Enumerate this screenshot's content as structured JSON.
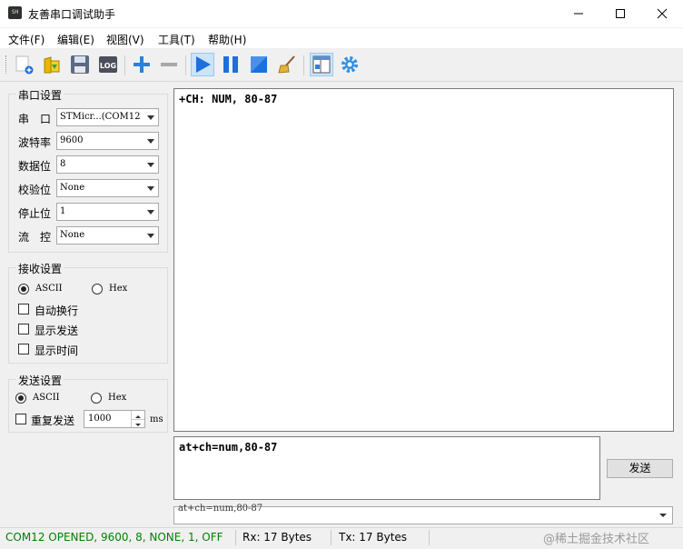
{
  "window": {
    "title": "友善串口调试助手",
    "icon_text": "SH",
    "controls": [
      "minimize",
      "maximize",
      "close"
    ]
  },
  "menu": [
    "文件(F)",
    "编辑(E)",
    "视图(V)",
    "工具(T)",
    "帮助(H)"
  ],
  "toolbar": {
    "icons": [
      "new-icon",
      "open-icon",
      "save-icon",
      "log-icon",
      "add-icon",
      "remove-icon",
      "play-icon",
      "pause-icon",
      "stop-icon",
      "clear-icon",
      "layout-icon",
      "settings-icon"
    ],
    "log_text": "LOG",
    "pressed": [
      "play-icon",
      "layout-icon"
    ]
  },
  "serial": {
    "title": "串口设置",
    "fields": [
      {
        "label": "串　口",
        "value": "STMicr...(COM12"
      },
      {
        "label": "波特率",
        "value": "9600"
      },
      {
        "label": "数据位",
        "value": "8"
      },
      {
        "label": "校验位",
        "value": "None"
      },
      {
        "label": "停止位",
        "value": "1"
      },
      {
        "label": "流　控",
        "value": "None"
      }
    ]
  },
  "receive": {
    "title": "接收设置",
    "ascii": "ASCII",
    "hex": "Hex",
    "selected": "ASCII",
    "options": [
      {
        "label": "自动换行",
        "checked": false
      },
      {
        "label": "显示发送",
        "checked": false
      },
      {
        "label": "显示时间",
        "checked": false
      }
    ]
  },
  "send": {
    "title": "发送设置",
    "ascii": "ASCII",
    "hex": "Hex",
    "selected": "ASCII",
    "repeat_label": "重复发送",
    "repeat_checked": false,
    "interval": "1000",
    "unit": "ms"
  },
  "receive_text": "+CH: NUM, 80-87",
  "send_text": "at+ch=num,80-87",
  "send_button": "发送",
  "history_value": "at+ch=num,80-87",
  "status": {
    "port": "COM12 OPENED, 9600, 8, NONE, 1, OFF",
    "rx": "Rx: 17 Bytes",
    "tx": "Tx: 17 Bytes",
    "port_color": "#008000"
  },
  "watermark": "@稀土掘金技术社区"
}
